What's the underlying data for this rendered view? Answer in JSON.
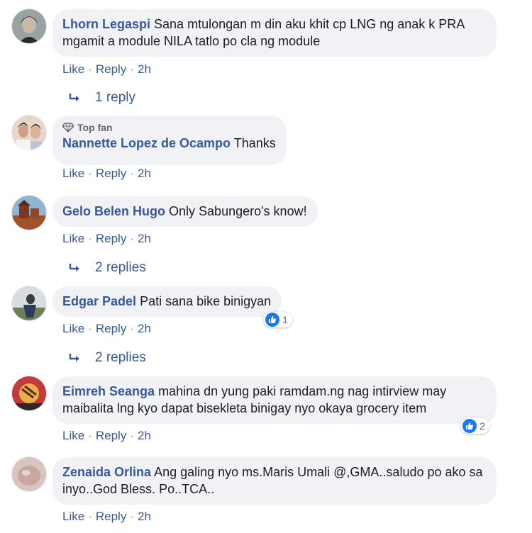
{
  "comments": [
    {
      "author": "Lhorn Legaspi",
      "text": "Sana mtulongan m din aku khit cp LNG ng anak k PRA mgamit a module NILA tatlo po cla ng module",
      "like_label": "Like",
      "reply_label": "Reply",
      "time": "2h",
      "replies_label": "1 reply"
    },
    {
      "badge": "Top fan",
      "author": "Nannette Lopez de Ocampo",
      "text": "Thanks",
      "like_label": "Like",
      "reply_label": "Reply",
      "time": "2h"
    },
    {
      "author": "Gelo Belen Hugo",
      "text": "Only Sabungero's know!",
      "like_label": "Like",
      "reply_label": "Reply",
      "time": "2h",
      "replies_label": "2 replies"
    },
    {
      "author": "Edgar Padel",
      "text": "Pati sana bike binigyan",
      "like_label": "Like",
      "reply_label": "Reply",
      "time": "2h",
      "reaction_count": "1",
      "replies_label": "2 replies"
    },
    {
      "author": "Eimreh Seanga",
      "text": "mahina dn yung paki ramdam.ng nag intirview may maibalita lng kyo dapat bisekleta binigay nyo okaya grocery item",
      "like_label": "Like",
      "reply_label": "Reply",
      "time": "2h",
      "reaction_count": "2"
    },
    {
      "author": "Zenaida Orlina",
      "text": "Ang galing nyo ms.Maris Umali @,GMA..saludo po ako sa inyo..God Bless. Po..TCA..",
      "like_label": "Like",
      "reply_label": "Reply",
      "time": "2h"
    }
  ],
  "colors": {
    "author": "#385898",
    "bubble": "#f0f2f5",
    "like_blue": "#1877f2"
  }
}
